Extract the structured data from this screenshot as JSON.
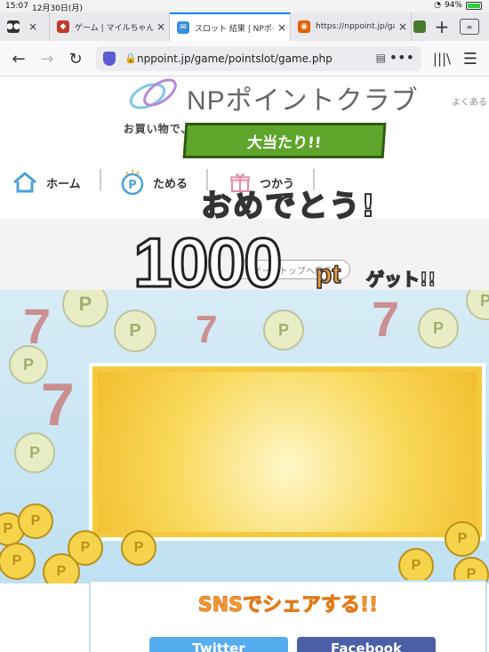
{
  "status": {
    "time": "15:07",
    "date": "12月30日(月)",
    "battery": "94%"
  },
  "tabs": [
    {
      "title": "",
      "icon": "mask-icon",
      "color": "#333333"
    },
    {
      "title": "ゲーム | マイルちゃん",
      "icon": "game-icon",
      "color": "#c0392b"
    },
    {
      "title": "スロット 結果 | NPポイ",
      "icon": "mail-icon",
      "color": "#3b8fd9"
    },
    {
      "title": "https://nppoint.jp/ga",
      "icon": "firefox-icon",
      "color": "#e66000"
    },
    {
      "title": "",
      "icon": "app-icon",
      "color": "#4a7a2f"
    }
  ],
  "tab_count": "∞",
  "address": {
    "url": "nppoint.jp/game/pointslot/game.php"
  },
  "site": {
    "logo_text": "NPポイントクラブ",
    "faq": "よくある",
    "tagline": "お買い物で、もっとうれしく、もっと楽しく。",
    "nav": [
      {
        "label": "ホーム",
        "icon": "home-icon"
      },
      {
        "label": "ためる",
        "icon": "point-icon"
      },
      {
        "label": "つかう",
        "icon": "gift-icon"
      }
    ],
    "back_button": "ゲームトップへ戻る"
  },
  "result": {
    "ribbon": "大当たり!!",
    "congrats": "おめでとう!",
    "points": "1000",
    "unit": "pt",
    "get": "ゲット!!"
  },
  "share": {
    "title": "SNSでシェアする!!",
    "twitter": "Twitter",
    "facebook": "Facebook"
  },
  "colors": {
    "twitter": "#55acee",
    "facebook": "#4a5fa6",
    "accent": "#f29a3a"
  }
}
